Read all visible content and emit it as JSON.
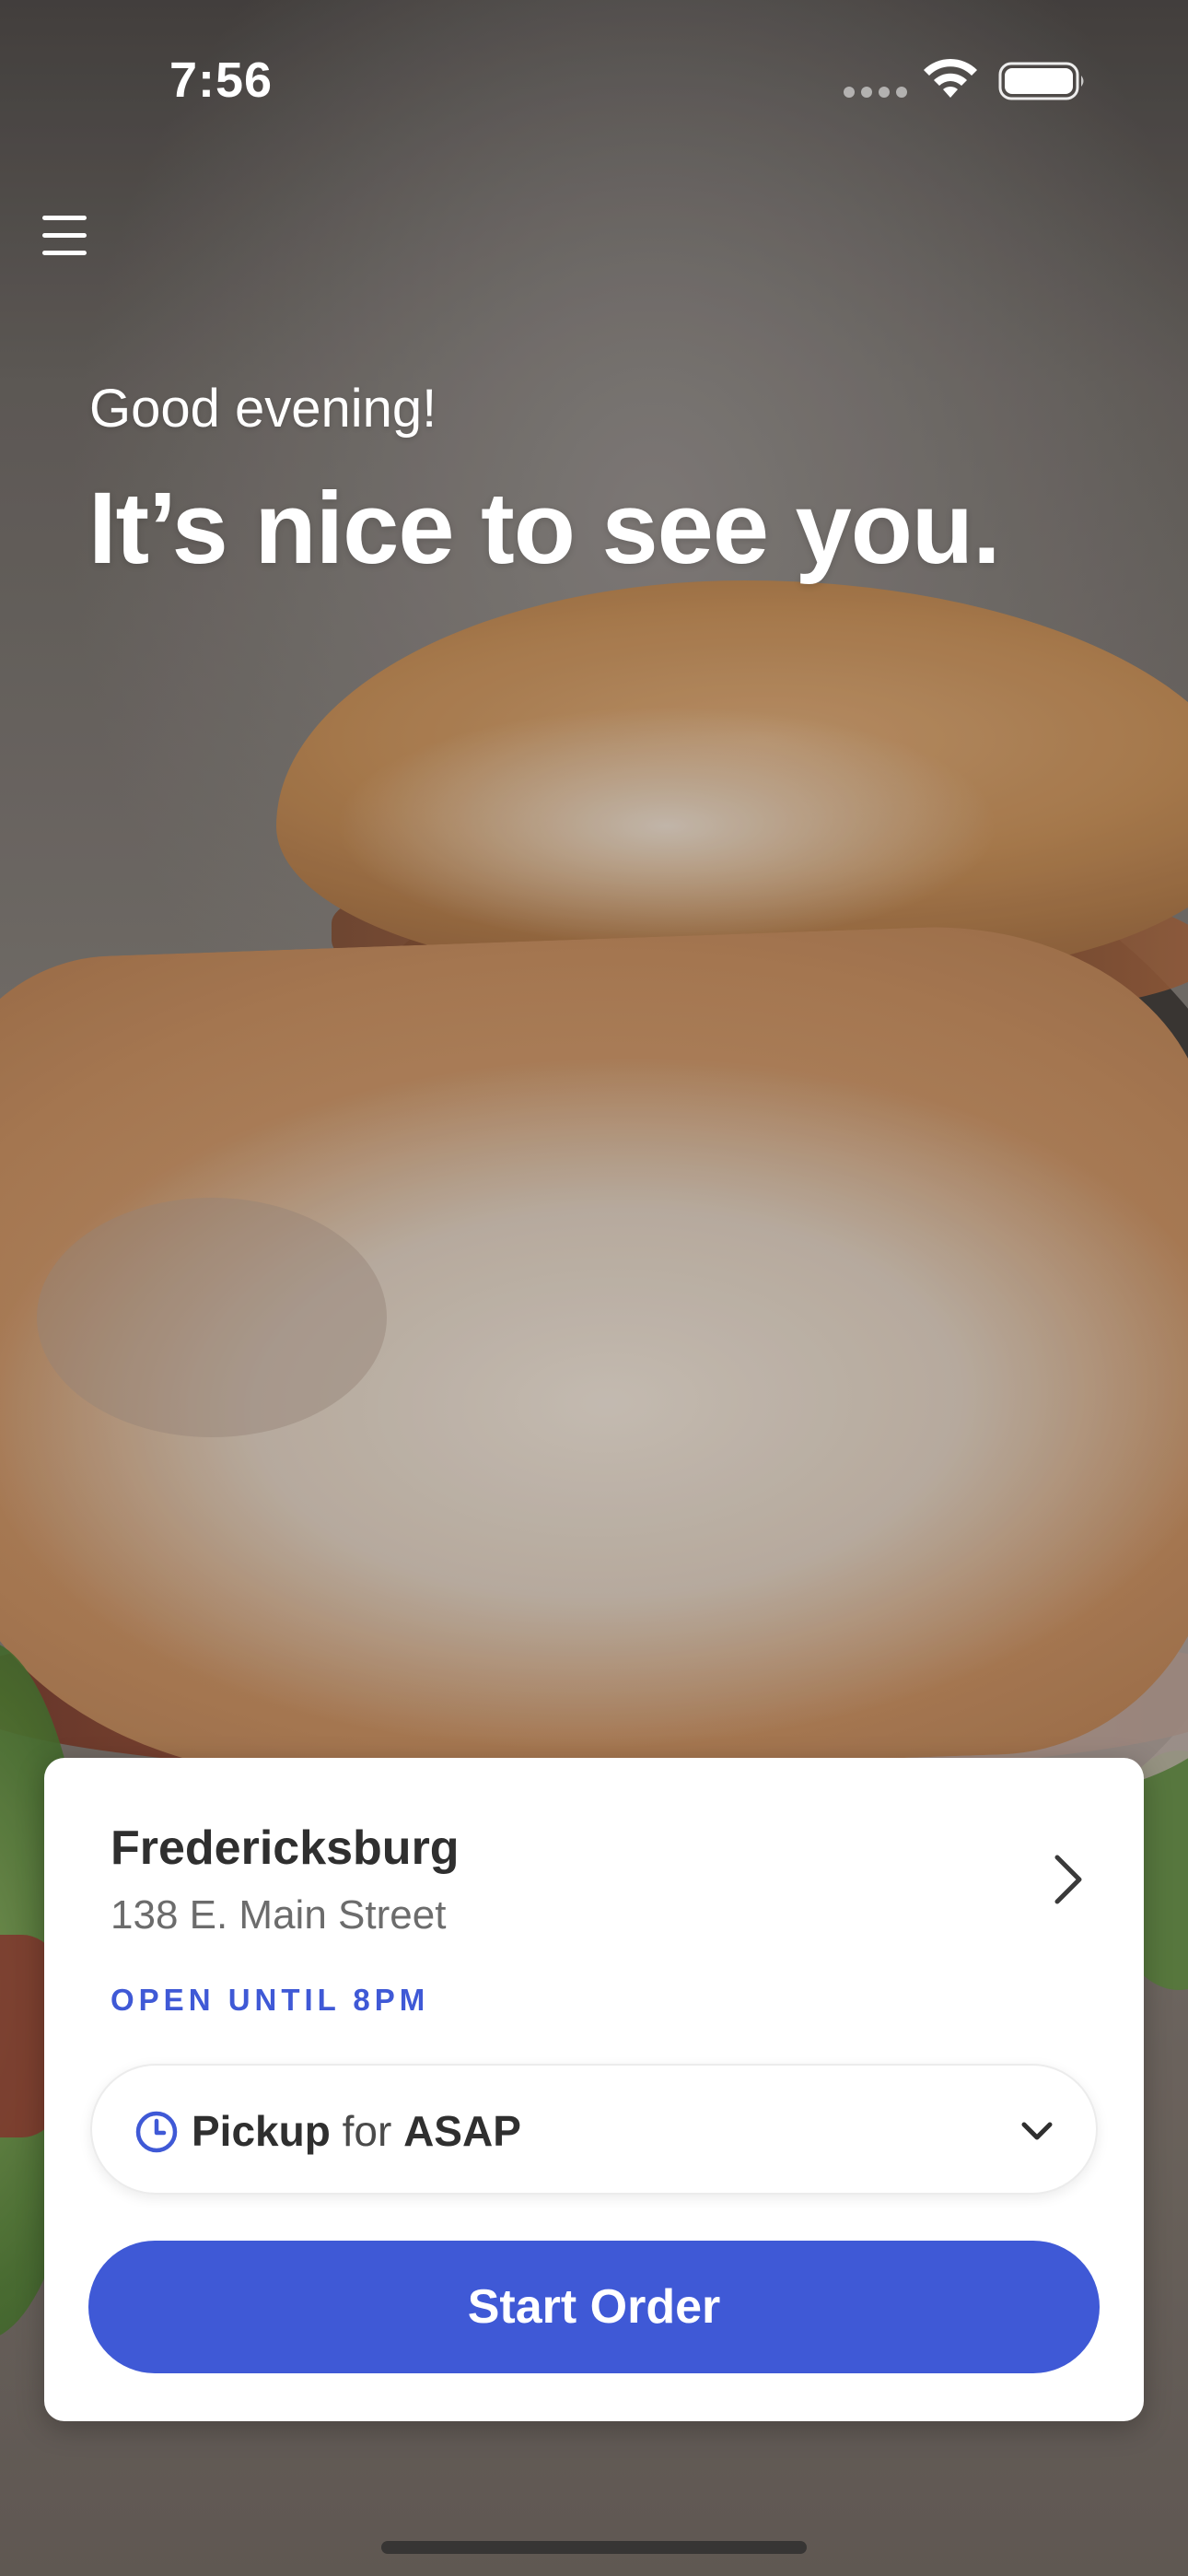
{
  "status_bar": {
    "time": "7:56",
    "signal_icon": "cellular-signal-dots-icon",
    "wifi_icon": "wifi-icon",
    "battery_icon": "battery-icon"
  },
  "header": {
    "menu_icon": "hamburger-menu-icon"
  },
  "hero": {
    "greeting": "Good evening!",
    "headline": "It’s nice to see you.",
    "background_image": "sandwich-photo"
  },
  "store_card": {
    "name": "Fredericksburg",
    "address": "138 E. Main Street",
    "hours": "OPEN UNTIL 8PM",
    "chevron_icon": "chevron-right-icon"
  },
  "order_mode": {
    "mode": "Pickup",
    "connector": "for",
    "time": "ASAP",
    "icon": "clock-icon",
    "dropdown_icon": "chevron-down-icon"
  },
  "actions": {
    "start_order_label": "Start Order"
  },
  "colors": {
    "accent": "#3f59d6",
    "text_primary": "#2f2f2f",
    "text_secondary": "#6c6c6c",
    "card_background": "#ffffff"
  }
}
